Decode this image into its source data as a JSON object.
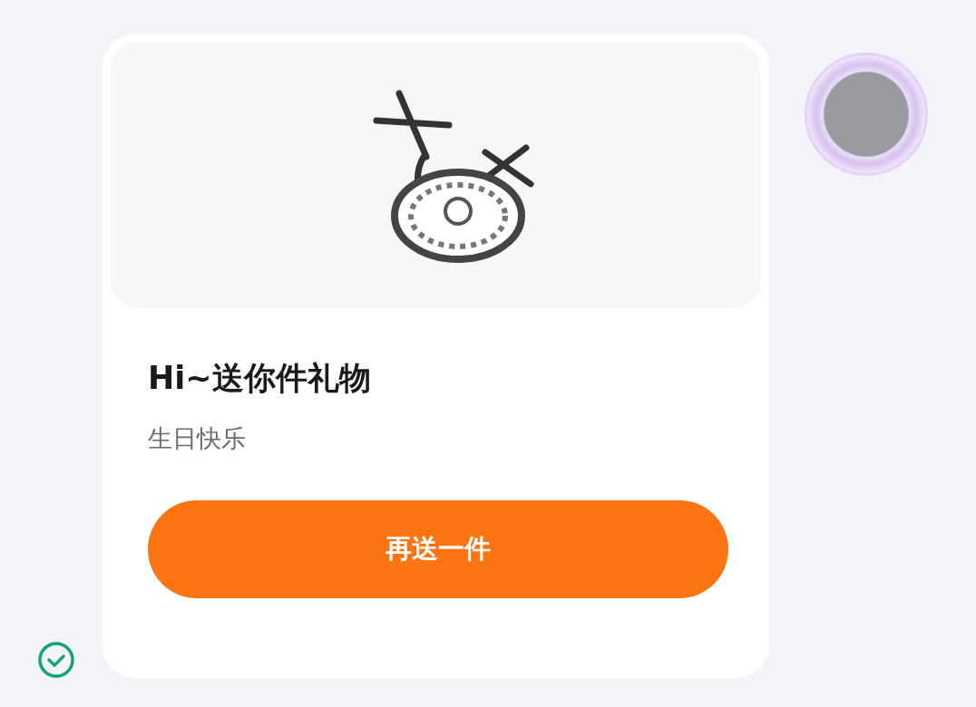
{
  "message": {
    "delivered": true,
    "gift_card": {
      "title": "Hi~送你件礼物",
      "subtitle": "生日快乐",
      "button": "再送一件"
    }
  }
}
